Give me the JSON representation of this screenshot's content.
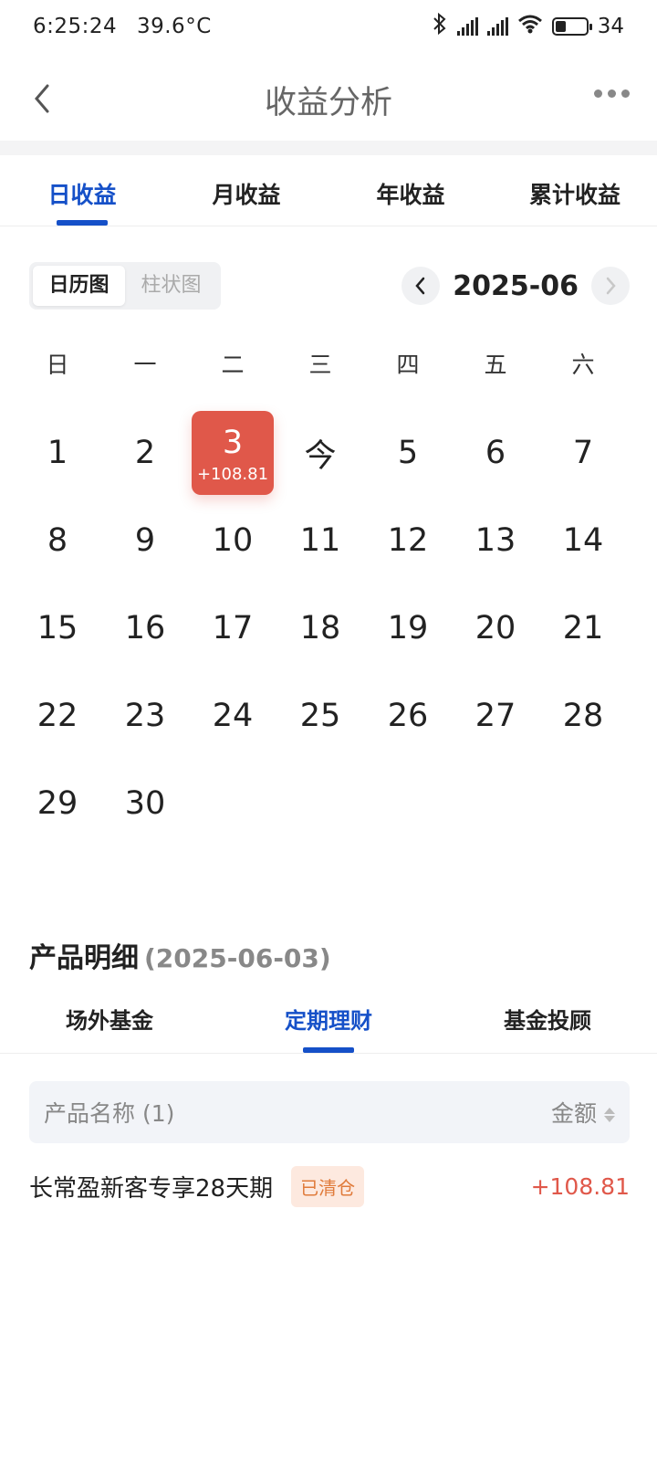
{
  "status_bar": {
    "time": "6:25:24",
    "temperature": "39.6°C",
    "battery": "34",
    "battery_level": 0.34
  },
  "header": {
    "title": "收益分析"
  },
  "main_tabs": [
    {
      "label": "日收益",
      "active": true
    },
    {
      "label": "月收益",
      "active": false
    },
    {
      "label": "年收益",
      "active": false
    },
    {
      "label": "累计收益",
      "active": false
    }
  ],
  "view_toggle": {
    "calendar": "日历图",
    "bar": "柱状图"
  },
  "month": "2025-06",
  "weekdays": [
    "日",
    "一",
    "二",
    "三",
    "四",
    "五",
    "六"
  ],
  "calendar": {
    "days": [
      "1",
      "2",
      "3",
      "今",
      "5",
      "6",
      "7",
      "8",
      "9",
      "10",
      "11",
      "12",
      "13",
      "14",
      "15",
      "16",
      "17",
      "18",
      "19",
      "20",
      "21",
      "22",
      "23",
      "24",
      "25",
      "26",
      "27",
      "28",
      "29",
      "30"
    ],
    "selected": {
      "day": "3",
      "amount": "+108.81"
    }
  },
  "detail": {
    "title": "产品明细",
    "date": "(2025-06-03)"
  },
  "sub_tabs": [
    {
      "label": "场外基金",
      "active": false
    },
    {
      "label": "定期理财",
      "active": true
    },
    {
      "label": "基金投顾",
      "active": false
    }
  ],
  "list": {
    "col_name": "产品名称 (1)",
    "col_amount": "金额",
    "rows": [
      {
        "name": "长常盈新客专享28天期",
        "badge": "已清仓",
        "amount": "+108.81"
      }
    ]
  },
  "colors": {
    "accent": "#1550c8",
    "profit": "#e0584a",
    "badge_bg": "#fde9df",
    "badge_text": "#e07b3b"
  }
}
